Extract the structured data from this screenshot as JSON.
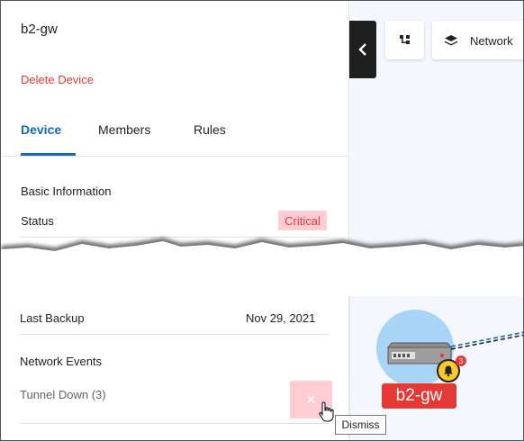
{
  "device": {
    "name": "b2-gw",
    "delete_label": "Delete Device"
  },
  "tabs": [
    {
      "label": "Device",
      "active": true
    },
    {
      "label": "Members",
      "active": false
    },
    {
      "label": "Rules",
      "active": false
    }
  ],
  "basic_info": {
    "heading": "Basic Information",
    "status_label": "Status",
    "status_value": "Critical",
    "last_backup_label": "Last Backup",
    "last_backup_value": "Nov 29, 2021"
  },
  "network_events": {
    "heading": "Network Events",
    "items": [
      {
        "label": "Tunnel Down (3)",
        "dismiss_icon": "close-icon"
      }
    ],
    "dismiss_tooltip": "Dismiss"
  },
  "canvas": {
    "toolbar": {
      "network_label": "Network"
    },
    "node": {
      "label": "b2-gw",
      "alert_count": "3"
    }
  },
  "colors": {
    "accent": "#1565c0",
    "critical": "#e53935",
    "critical_bg": "#ffcdd2",
    "node_circle": "#a8d4f5",
    "bell": "#ffca28"
  }
}
